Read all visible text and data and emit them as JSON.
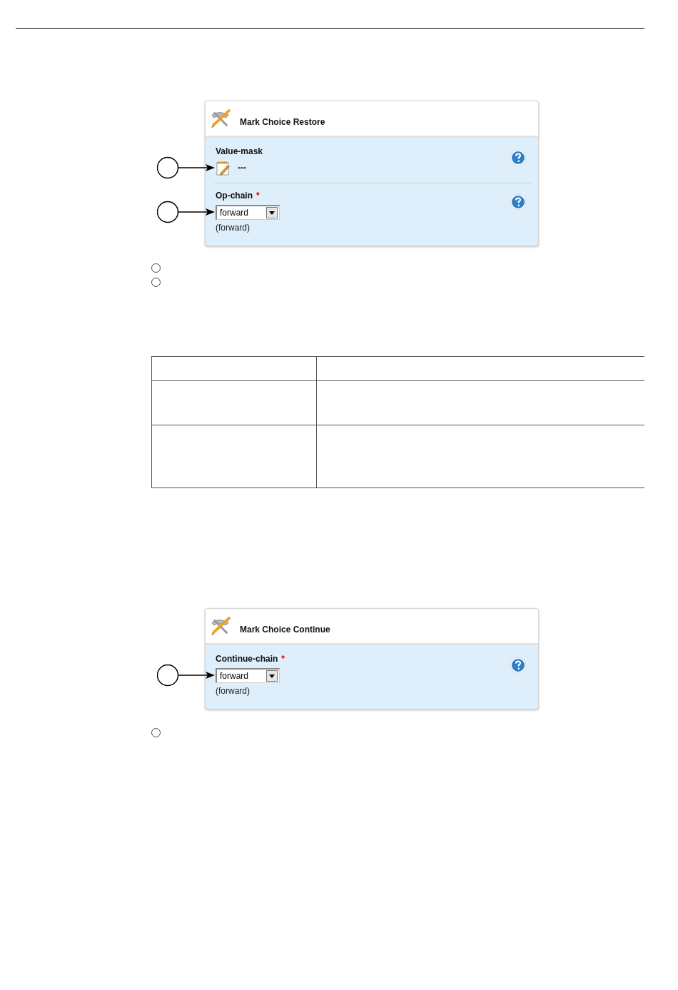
{
  "panels": [
    {
      "title": "Mark Choice Restore",
      "fields": [
        {
          "kind": "editable",
          "label": "Value-mask",
          "required": false,
          "value": "---",
          "callout": true
        },
        {
          "kind": "select",
          "label": "Op-chain",
          "required": true,
          "value": "forward",
          "default": "(forward)",
          "callout": true
        }
      ]
    },
    {
      "title": "Mark Choice Continue",
      "fields": [
        {
          "kind": "select",
          "label": "Continue-chain",
          "required": true,
          "value": "forward",
          "default": "(forward)",
          "callout": true
        }
      ]
    }
  ],
  "required_mark": "*"
}
